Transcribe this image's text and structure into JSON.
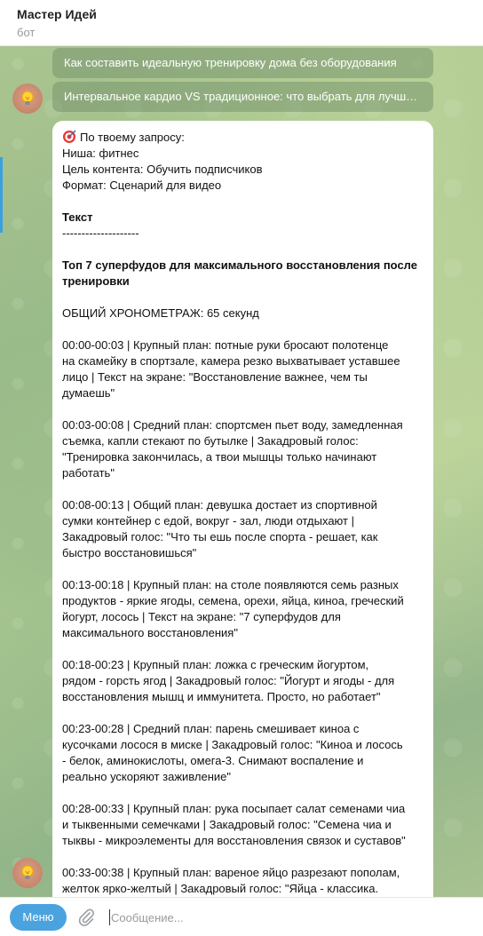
{
  "header": {
    "title": "Мастер Идей",
    "subtitle": "бот"
  },
  "keyboard": {
    "button1": "Как составить идеальную тренировку дома без оборудования",
    "button2": "Интервальное кардио VS традиционное: что выбрать для лучших результатов"
  },
  "message": {
    "request_header": "По твоему запросу:",
    "niche": "Ниша: фитнес",
    "goal": "Цель контента: Обучить подписчиков",
    "format": "Формат: Сценарий для видео",
    "text_heading": "Текст",
    "divider": "--------------------",
    "title_line1": "Топ 7 суперфудов для максимального восстановления после",
    "title_line2": "тренировки",
    "timing": "ОБЩИЙ ХРОНОМЕТРАЖ: 65 секунд",
    "scenes": [
      [
        "00:00-00:03 | Крупный план: потные руки бросают полотенце",
        "на скамейку в спортзале, камера резко выхватывает уставшее",
        "лицо | Текст на экране: \"Восстановление важнее, чем ты",
        "думаешь\""
      ],
      [
        "00:03-00:08 | Средний план: спортсмен пьет воду, замедленная",
        "съемка, капли стекают по бутылке | Закадровый голос:",
        "\"Тренировка закончилась, а твои мышцы только начинают",
        "работать\""
      ],
      [
        "00:08-00:13 | Общий план: девушка достает из спортивной",
        "сумки контейнер с едой, вокруг - зал, люди отдыхают |",
        "Закадровый голос: \"Что ты ешь после спорта - решает, как",
        "быстро восстановишься\""
      ],
      [
        "00:13-00:18 | Крупный план: на столе появляются семь разных",
        "продуктов - яркие ягоды, семена, орехи, яйца, киноа, греческий",
        "йогурт, лосось | Текст на экране: \"7 суперфудов для",
        "максимального восстановления\""
      ],
      [
        "00:18-00:23 | Крупный план: ложка с греческим йогуртом,",
        "рядом - горсть ягод | Закадровый голос: \"Йогурт и ягоды - для",
        "восстановления мышц и иммунитета. Просто, но работает\""
      ],
      [
        "00:23-00:28 | Средний план: парень смешивает киноа с",
        "кусочками лосося в миске | Закадровый голос: \"Киноа и лосось",
        "- белок, аминокислоты, омега-3. Снимают воспаление и",
        "реально ускоряют заживление\""
      ],
      [
        "00:28-00:33 | Крупный план: рука посыпает салат семенами чиа",
        "и тыквенными семечками | Закадровый голос: \"Семена чиа и",
        "тыквы - микроэлементы для восстановления связок и суставов\""
      ],
      [
        "00:33-00:38 | Крупный план: вареное яйцо разрезают пополам,",
        "желток ярко-желтый | Закадровый голос: \"Яйца - классика."
      ]
    ]
  },
  "input": {
    "menu_label": "Меню",
    "placeholder": "Сообщение..."
  },
  "icons": {
    "target": "target-dart-icon",
    "avatar": "lightbulb-avatar-icon",
    "attach": "paperclip-icon"
  },
  "colors": {
    "accent": "#4aa3df",
    "chat_bg": "#a9c48f",
    "keyboard_btn": "#7f9a6e"
  }
}
